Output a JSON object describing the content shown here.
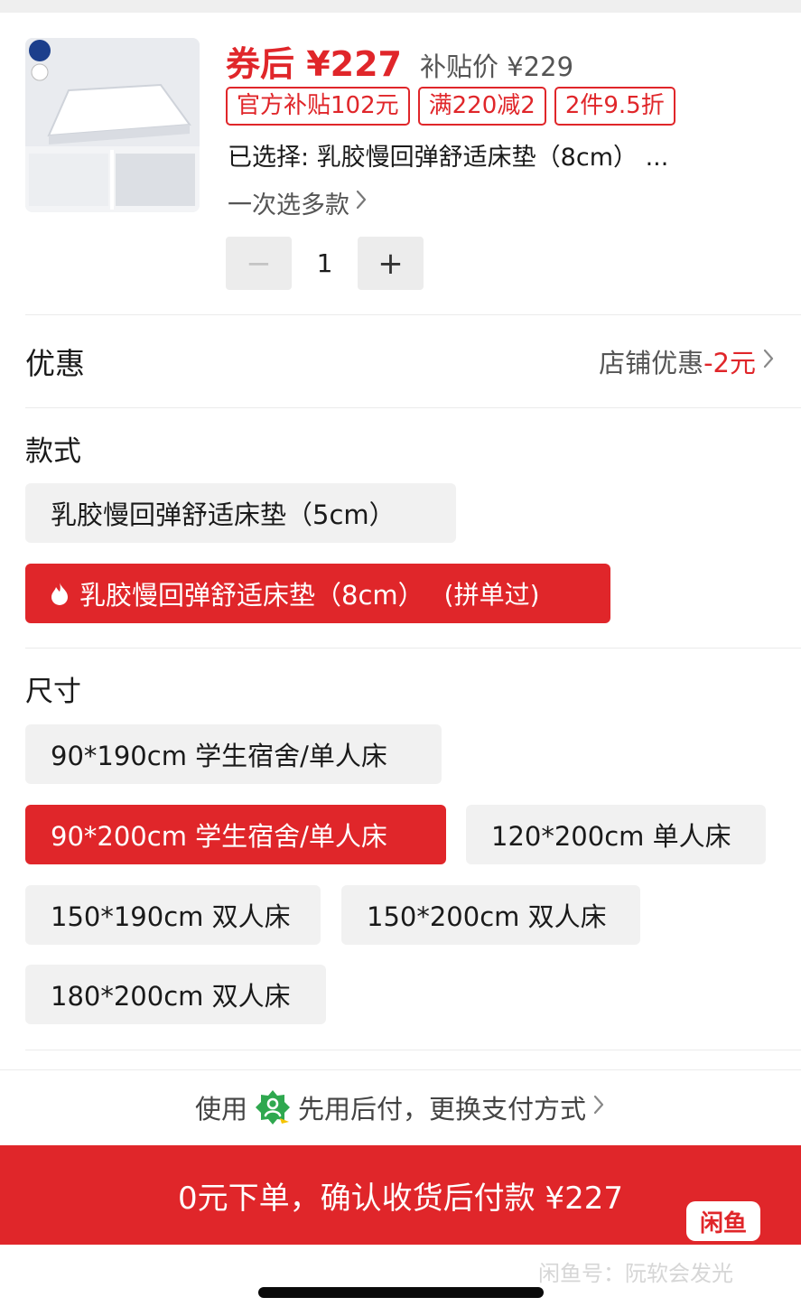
{
  "product": {
    "price_after_coupon": "券后 ¥227",
    "subsidy_price": "补贴价 ¥229",
    "tags": [
      "官方补贴102元",
      "满220减2",
      "2件9.5折"
    ],
    "selected_text": "已选择: 乳胶慢回弹舒适床垫（8cm） ...",
    "multi_select_label": "一次选多款",
    "quantity": "1",
    "quantity_minus": "−",
    "quantity_plus": "+"
  },
  "discount": {
    "label": "优惠",
    "store_prefix": "店铺优惠",
    "store_amount": "-2元"
  },
  "style_section": {
    "title": "款式",
    "options": [
      {
        "label": "乳胶慢回弹舒适床垫（5cm）",
        "selected": false
      },
      {
        "label": "乳胶慢回弹舒适床垫（8cm）",
        "suffix": "(拼单过)",
        "selected": true,
        "icon": "flame-icon"
      }
    ]
  },
  "size_section": {
    "title": "尺寸",
    "options": [
      {
        "label": "90*190cm 学生宿舍/单人床",
        "selected": false
      },
      {
        "label": "90*200cm 学生宿舍/单人床",
        "selected": true
      },
      {
        "label": "120*200cm 单人床",
        "selected": false
      },
      {
        "label": "150*190cm 双人床",
        "selected": false
      },
      {
        "label": "150*200cm 双人床",
        "selected": false
      },
      {
        "label": "180*200cm 双人床",
        "selected": false
      }
    ]
  },
  "payment": {
    "prefix": "使用",
    "text": "先用后付，更换支付方式"
  },
  "cta": {
    "label": "0元下单，确认收货后付款 ¥227"
  },
  "overlay": {
    "badge": "闲鱼",
    "watermark": "闲鱼号：阮软会发光"
  },
  "colors": {
    "accent": "#e0262a",
    "chip_bg": "#f1f1f1",
    "muted_text": "#555555"
  }
}
